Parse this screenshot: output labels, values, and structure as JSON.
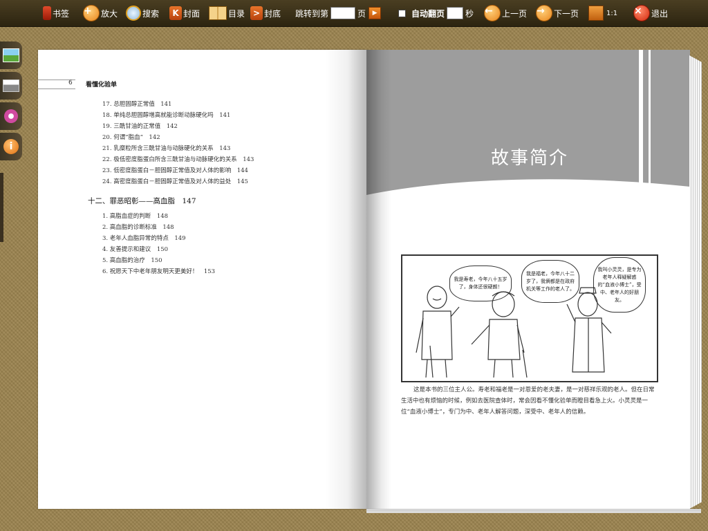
{
  "toolbar": {
    "bookmark": "书签",
    "zoom": "放大",
    "search": "搜索",
    "cover": "封面",
    "toc": "目录",
    "back_cover": "封底",
    "jump_prefix": "跳转到第",
    "jump_suffix": "页",
    "auto_flip": "自动翻页",
    "seconds": "秒",
    "prev_page": "上一页",
    "next_page": "下一页",
    "ratio": "1:1",
    "exit": "退出"
  },
  "left_page": {
    "page_number": "6",
    "running_header": "看懂化验单",
    "items_a": [
      "17. 总胆固醇正常值　141",
      "18. 单纯总胆固醇增高就能诊断动脉硬化吗　141",
      "19. 三酰甘油的正常值　142",
      "20. 何谓“脂血”　142",
      "21. 乳糜粒所含三酰甘油与动脉硬化的关系　143",
      "22. 极低密度脂蛋白所含三酰甘油与动脉硬化的关系　143",
      "23. 低密度脂蛋白－胆固醇正常值及对人体的影响　144",
      "24. 高密度脂蛋白－胆固醇正常值及对人体的益处　145"
    ],
    "section": "十二、罪恶昭彰——高血脂　147",
    "items_b": [
      "1. 高脂血症的判断　148",
      "2. 高血脂的诊断标准　148",
      "3. 老年人血脂异常的特点　149",
      "4. 友善提示和建议　150",
      "5. 高血脂的治疗　150",
      "6. 祝愿天下中老年朋友明天更美好！　153"
    ]
  },
  "right_page": {
    "title": "故事简介",
    "bubbles": [
      "我是寿老，今年八十五岁了，身体还很硬朗！",
      "我是福老，今年八十二岁了，我俩都是在政府机关等工作的老人了。",
      "我叫小灵灵，是专为老年人释疑解惑的“血液小博士”，受中、老年人的好朋友。"
    ],
    "caption": "这是本书的三位主人公。寿老和福老是一对恩爱的老夫妻，是一对慈祥乐观的老人。但在日常生活中也有烦恼的时候，例如去医院查体时，常会因看不懂化验单而瞪目看急上火。小灵灵是一位“血液小博士”，专门为中、老年人解答问题，深受中、老年人的信赖。"
  },
  "colors": {
    "toolbar": "#2c2410",
    "background": "#9c8450",
    "gray_band": "#9d9d9d",
    "accent_orange": "#e8742a"
  }
}
